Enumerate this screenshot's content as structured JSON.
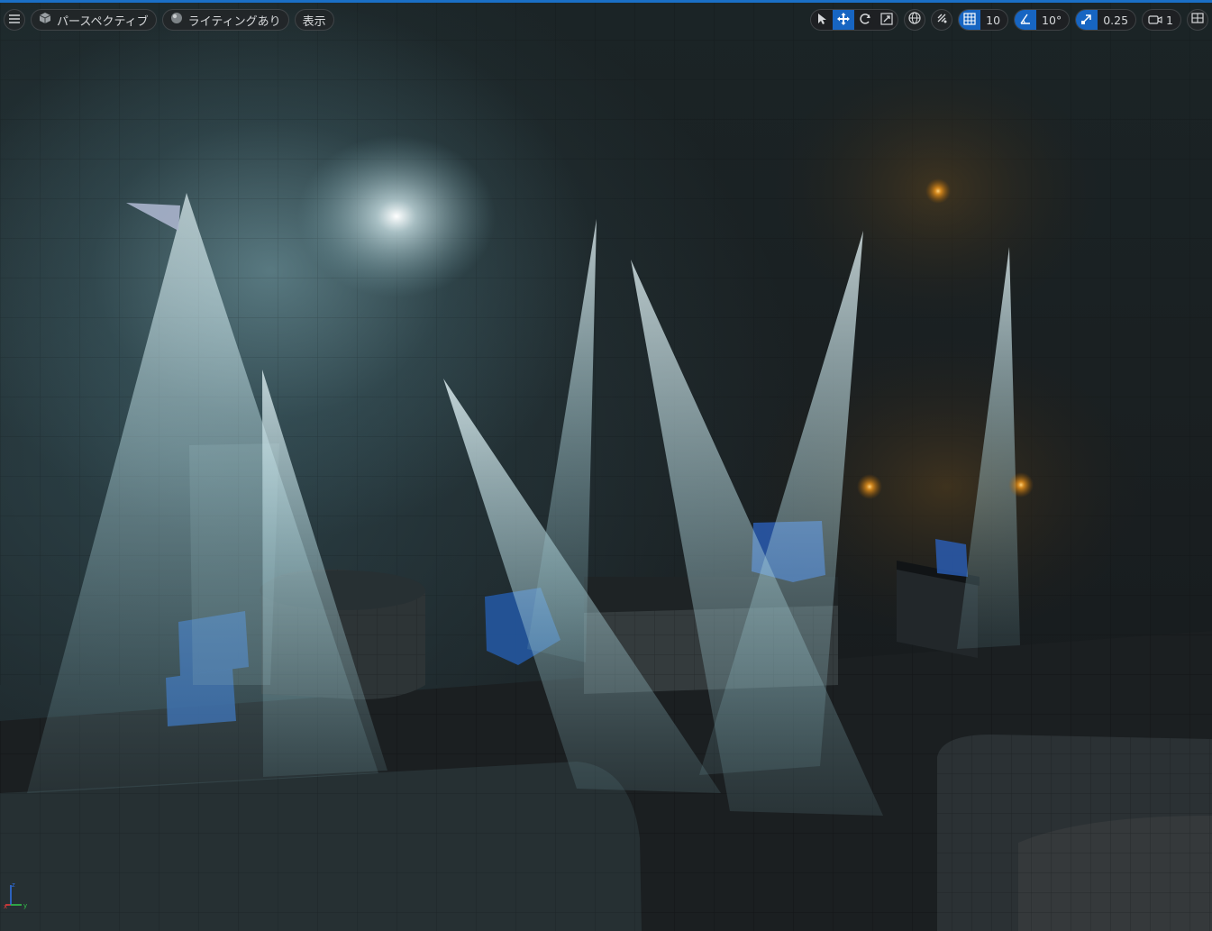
{
  "viewport": {
    "perspective_label": "パースペクティブ",
    "lighting_label": "ライティングあり",
    "show_label": "表示",
    "grid_snap_value": "10",
    "rotation_snap_value": "10°",
    "scale_snap_value": "0.25",
    "camera_speed_value": "1"
  },
  "icons": {
    "hamburger": "menu-icon",
    "perspective": "cube-icon",
    "lighting": "sphere-icon",
    "select": "cursor-icon",
    "translate": "move-arrows-icon",
    "rotate": "rotate-icon",
    "scale": "scale-icon",
    "world": "globe-icon",
    "surface_snap": "surface-snap-icon",
    "grid": "grid-icon",
    "angle": "angle-icon",
    "scale_snap": "scale-snap-icon",
    "camera": "camera-icon",
    "layout": "layout-grid-icon"
  },
  "colors": {
    "accent": "#1765c2",
    "light_beam": "#bfe3ea",
    "point_light": "#f59a1c",
    "floor": "#1a1e20"
  }
}
